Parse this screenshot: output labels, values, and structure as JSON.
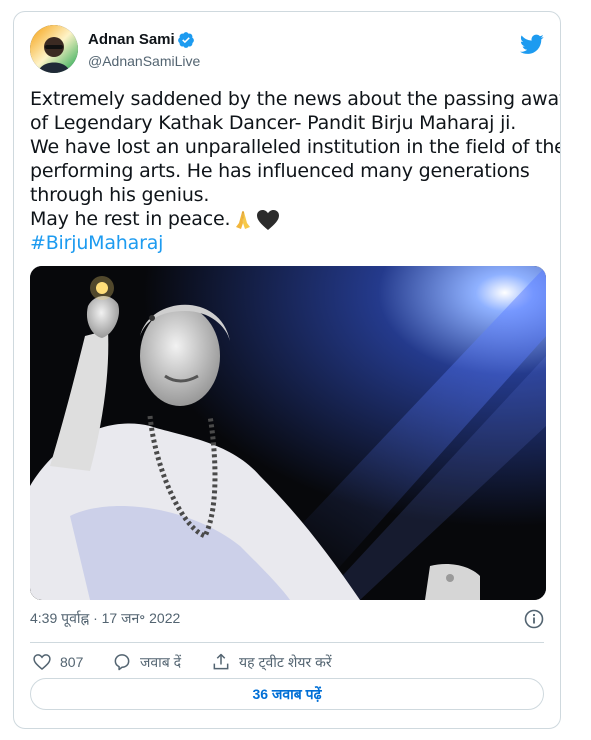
{
  "tweet": {
    "author": {
      "display_name": "Adnan Sami",
      "handle": "@AdnanSamiLive",
      "verified": true
    },
    "text_lines": [
      "Extremely saddened by the news about the passing away",
      "of Legendary Kathak Dancer- Pandit Birju Maharaj ji.",
      "We have lost an unparalleled institution in the field of the",
      "performing arts. He has influenced many generations",
      "through his genius.",
      "May he rest in peace."
    ],
    "emojis": [
      "folded-hands",
      "black-heart"
    ],
    "hashtag": "#BirjuMaharaj",
    "timestamp": "4:39 पूर्वाह्न · 17 जन॰ 2022",
    "actions": {
      "like_count": "807",
      "reply_label": "जवाब दें",
      "share_label": "यह ट्वीट शेयर करें"
    },
    "replies_button_label": "36 जवाब पढ़ें"
  },
  "icons": {
    "brand": "twitter-bird-icon",
    "verified": "verified-badge-icon",
    "info": "info-icon",
    "like": "heart-icon",
    "reply": "reply-icon",
    "share": "share-icon"
  },
  "colors": {
    "twitter_blue": "#1d9bf0",
    "text_primary": "#0f1419",
    "text_secondary": "#536471",
    "border": "#cfd9de",
    "link": "#006fd6"
  }
}
